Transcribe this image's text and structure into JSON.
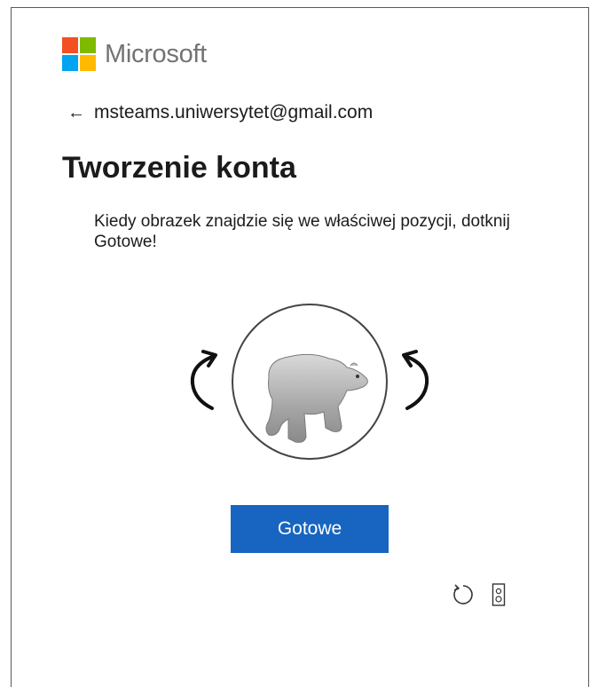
{
  "brand": {
    "name": "Microsoft",
    "logo_colors": [
      "#f25022",
      "#7fba00",
      "#00a4ef",
      "#ffb900"
    ]
  },
  "identity": {
    "back_icon": "arrow-left-icon",
    "email": "msteams.uniwersytet@gmail.com"
  },
  "page": {
    "title": "Tworzenie konta",
    "instructions": "Kiedy obrazek znajdzie się we właściwej pozycji, dotknij Gotowe!"
  },
  "puzzle": {
    "image_subject": "bear",
    "rotate_left_icon": "rotate-counterclockwise-icon",
    "rotate_right_icon": "rotate-clockwise-icon"
  },
  "actions": {
    "done_label": "Gotowe",
    "accent_color": "#1765c0"
  },
  "footer": {
    "icons": [
      "refresh-icon",
      "audio-challenge-icon"
    ]
  }
}
